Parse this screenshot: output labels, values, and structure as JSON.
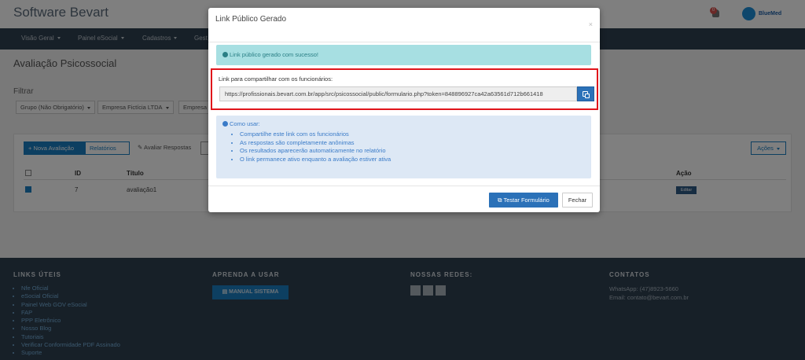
{
  "app": {
    "title": "Software Bevart",
    "notification_count": "0",
    "brand_logo": "BlueMed"
  },
  "nav": {
    "items": [
      "Visão Geral",
      "Painel eSocial",
      "Cadastros",
      "Gest"
    ]
  },
  "page": {
    "title": "Avaliação Psicossocial"
  },
  "filter": {
    "label": "Filtrar",
    "group": "Grupo (Não Obrigatório)",
    "company": "Empresa Fictícia LTDA",
    "company2": "Empresa"
  },
  "toolbar": {
    "new": "+ Nova Avaliação",
    "reports": "Relatórios",
    "evaluate": "Avaliar Respostas",
    "actions": "Ações"
  },
  "table": {
    "headers": {
      "id": "ID",
      "title": "Título",
      "action": "Ação"
    },
    "rows": [
      {
        "id": "7",
        "title": "avaliação1",
        "edit": "Editar"
      }
    ]
  },
  "footer": {
    "links_title": "LINKS ÚTEIS",
    "links": [
      "Nfe Oficial",
      "eSocial Oficial",
      "Painel Web GOV eSocial",
      "FAP",
      "PPP Eletrônico",
      "Nosso Blog",
      "Tutoriais",
      "Verificar Conformidade PDF Assinado",
      "Suporte"
    ],
    "learn_title": "APRENDA A USAR",
    "manual": "MANUAL SISTEMA",
    "social_title": "NOSSAS REDES:",
    "contact_title": "CONTATOS",
    "whatsapp": "WhatsApp: (47)8923-5660",
    "email": "Email: contato@bevart.com.br"
  },
  "modal": {
    "title": "Link Público Gerado",
    "close": "×",
    "success": "Link público gerado com sucesso!",
    "share_label": "Link para compartilhar com os funcionários:",
    "link_value": "https://profissionais.bevart.com.br/app/src/psicossocial/public/formulario.php?token=848896927ca42a63561d712b661418",
    "howto_title": "Como usar:",
    "howto": [
      "Compartilhe este link com os funcionários",
      "As respostas são completamente anônimas",
      "Os resultados aparecerão automaticamente no relatório",
      "O link permanece ativo enquanto a avaliação estiver ativa"
    ],
    "test_button": "Testar Formulário",
    "close_button": "Fechar"
  }
}
